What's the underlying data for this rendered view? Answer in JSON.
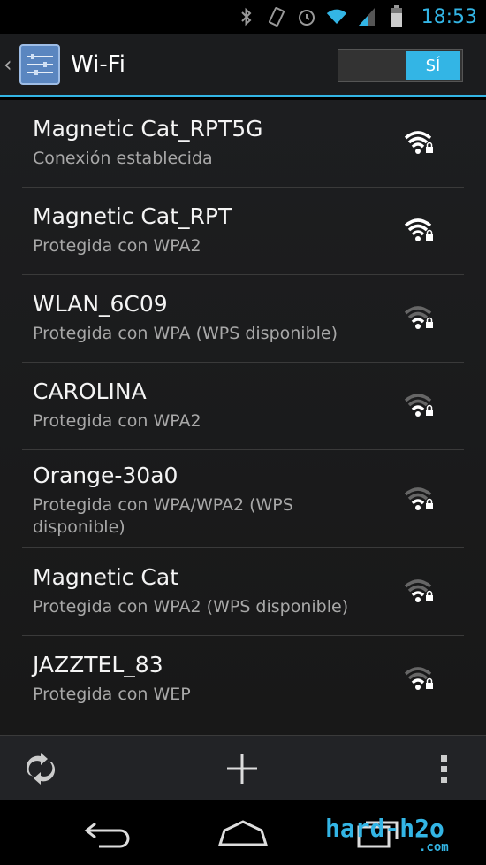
{
  "status_bar": {
    "time": "18:53",
    "icons": [
      "bluetooth-icon",
      "vibrate-icon",
      "alarm-icon",
      "wifi-status-icon",
      "signal-icon",
      "battery-icon"
    ]
  },
  "action_bar": {
    "title": "Wi-Fi",
    "toggle_label": "SÍ",
    "toggle_state": "on"
  },
  "networks": [
    {
      "name": "Magnetic Cat_RPT5G",
      "status": "Conexión establecida",
      "signal": "strong",
      "secured": true
    },
    {
      "name": "Magnetic Cat_RPT",
      "status": "Protegida con WPA2",
      "signal": "strong",
      "secured": true
    },
    {
      "name": "WLAN_6C09",
      "status": "Protegida con WPA (WPS disponible)",
      "signal": "weak",
      "secured": true
    },
    {
      "name": "CAROLINA",
      "status": "Protegida con WPA2",
      "signal": "weak",
      "secured": true
    },
    {
      "name": "Orange-30a0",
      "status": "Protegida con WPA/WPA2 (WPS disponible)",
      "signal": "weak",
      "secured": true
    },
    {
      "name": "Magnetic Cat",
      "status": "Protegida con WPA2 (WPS disponible)",
      "signal": "weak",
      "secured": true
    },
    {
      "name": "JAZZTEL_83",
      "status": "Protegida con WEP",
      "signal": "weak",
      "secured": true
    }
  ],
  "bottom_bar": {
    "icons": [
      "scan-icon",
      "add-network-icon",
      "overflow-menu-icon"
    ]
  },
  "nav_bar": {
    "icons": [
      "back-icon",
      "home-icon",
      "recents-icon"
    ]
  },
  "watermark": {
    "text": "hard-h2o",
    "sub": ".com"
  },
  "colors": {
    "accent": "#33b5e5",
    "background": "#1b1c1e",
    "primary_text": "#f4f4f4",
    "secondary_text": "#a8a8a8"
  }
}
